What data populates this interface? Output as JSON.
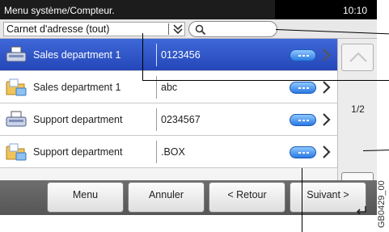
{
  "header": {
    "title": "Menu système/Compteur.",
    "time": "10:10"
  },
  "filter": {
    "address_book": "Carnet d'adresse (tout)"
  },
  "contacts": [
    {
      "name": "Sales department 1",
      "number": "0123456",
      "type": "fax",
      "selected": true
    },
    {
      "name": "Sales department 1",
      "number": "abc",
      "type": "folder",
      "selected": false
    },
    {
      "name": "Support department",
      "number": "0234567",
      "type": "fax",
      "selected": false
    },
    {
      "name": "Support department",
      "number": ".BOX",
      "type": "folder",
      "selected": false
    }
  ],
  "pagination": {
    "page": "1/2"
  },
  "buttons": {
    "menu": "Menu",
    "cancel": "Annuler",
    "back": "< Retour",
    "next": "Suivant >"
  },
  "figure_code": "GB0429_00",
  "colors": {
    "selection": "#2e52c8",
    "title_bar": "#1c1c1c",
    "detail_button": "#3a8ae8"
  }
}
